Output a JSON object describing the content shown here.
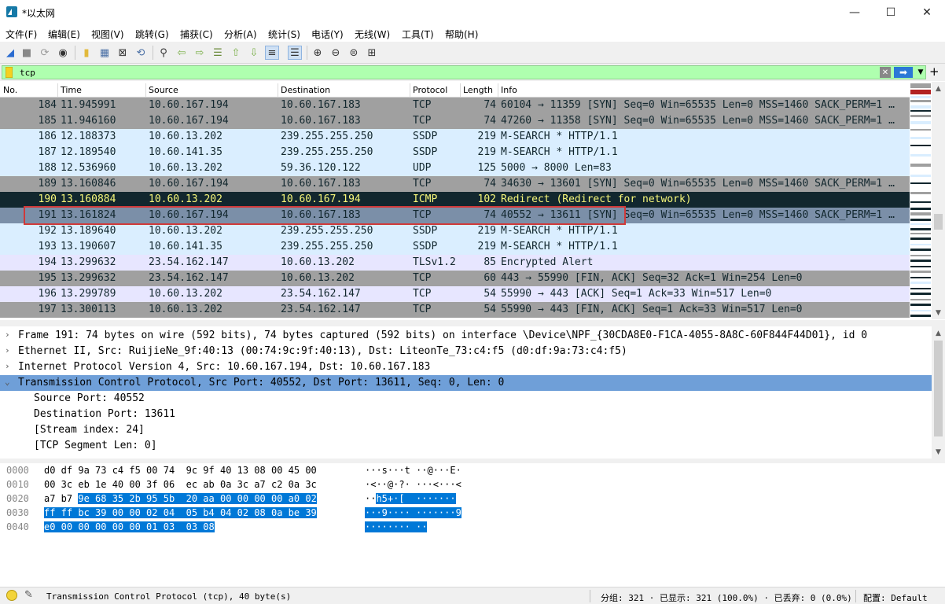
{
  "window": {
    "title": "*以太网"
  },
  "menu": [
    "文件(F)",
    "编辑(E)",
    "视图(V)",
    "跳转(G)",
    "捕获(C)",
    "分析(A)",
    "统计(S)",
    "电话(Y)",
    "无线(W)",
    "工具(T)",
    "帮助(H)"
  ],
  "filter": {
    "value": "tcp"
  },
  "columns": [
    "No.",
    "Time",
    "Source",
    "Destination",
    "Protocol",
    "Length",
    "Info"
  ],
  "packets": [
    {
      "no": "184",
      "time": "11.945991",
      "src": "10.60.167.194",
      "dst": "10.60.167.183",
      "proto": "TCP",
      "len": "74",
      "info": "60104 → 11359 [SYN] Seq=0 Win=65535 Len=0 MSS=1460 SACK_PERM=1 …",
      "bg": "#a0a0a0",
      "fg": "#12272e"
    },
    {
      "no": "185",
      "time": "11.946160",
      "src": "10.60.167.194",
      "dst": "10.60.167.183",
      "proto": "TCP",
      "len": "74",
      "info": "47260 → 11358 [SYN] Seq=0 Win=65535 Len=0 MSS=1460 SACK_PERM=1 …",
      "bg": "#a0a0a0",
      "fg": "#12272e"
    },
    {
      "no": "186",
      "time": "12.188373",
      "src": "10.60.13.202",
      "dst": "239.255.255.250",
      "proto": "SSDP",
      "len": "219",
      "info": "M-SEARCH * HTTP/1.1",
      "bg": "#daeeff",
      "fg": "#12272e"
    },
    {
      "no": "187",
      "time": "12.189540",
      "src": "10.60.141.35",
      "dst": "239.255.255.250",
      "proto": "SSDP",
      "len": "219",
      "info": "M-SEARCH * HTTP/1.1",
      "bg": "#daeeff",
      "fg": "#12272e"
    },
    {
      "no": "188",
      "time": "12.536960",
      "src": "10.60.13.202",
      "dst": "59.36.120.122",
      "proto": "UDP",
      "len": "125",
      "info": "5000 → 8000 Len=83",
      "bg": "#daeeff",
      "fg": "#12272e"
    },
    {
      "no": "189",
      "time": "13.160846",
      "src": "10.60.167.194",
      "dst": "10.60.167.183",
      "proto": "TCP",
      "len": "74",
      "info": "34630 → 13601 [SYN] Seq=0 Win=65535 Len=0 MSS=1460 SACK_PERM=1 …",
      "bg": "#a0a0a0",
      "fg": "#12272e"
    },
    {
      "no": "190",
      "time": "13.160884",
      "src": "10.60.13.202",
      "dst": "10.60.167.194",
      "proto": "ICMP",
      "len": "102",
      "info": "Redirect               (Redirect for network)",
      "bg": "#12272e",
      "fg": "#f7f77a"
    },
    {
      "no": "191",
      "time": "13.161824",
      "src": "10.60.167.194",
      "dst": "10.60.167.183",
      "proto": "TCP",
      "len": "74",
      "info": "40552 → 13611 [SYN] Seq=0 Win=65535 Len=0 MSS=1460 SACK_PERM=1 …",
      "bg": "#7b8fa8",
      "fg": "#12272e"
    },
    {
      "no": "192",
      "time": "13.189640",
      "src": "10.60.13.202",
      "dst": "239.255.255.250",
      "proto": "SSDP",
      "len": "219",
      "info": "M-SEARCH * HTTP/1.1",
      "bg": "#daeeff",
      "fg": "#12272e"
    },
    {
      "no": "193",
      "time": "13.190607",
      "src": "10.60.141.35",
      "dst": "239.255.255.250",
      "proto": "SSDP",
      "len": "219",
      "info": "M-SEARCH * HTTP/1.1",
      "bg": "#daeeff",
      "fg": "#12272e"
    },
    {
      "no": "194",
      "time": "13.299632",
      "src": "23.54.162.147",
      "dst": "10.60.13.202",
      "proto": "TLSv1.2",
      "len": "85",
      "info": "Encrypted Alert",
      "bg": "#e7e6ff",
      "fg": "#12272e"
    },
    {
      "no": "195",
      "time": "13.299632",
      "src": "23.54.162.147",
      "dst": "10.60.13.202",
      "proto": "TCP",
      "len": "60",
      "info": "443 → 55990 [FIN, ACK] Seq=32 Ack=1 Win=254 Len=0",
      "bg": "#a0a0a0",
      "fg": "#12272e"
    },
    {
      "no": "196",
      "time": "13.299789",
      "src": "10.60.13.202",
      "dst": "23.54.162.147",
      "proto": "TCP",
      "len": "54",
      "info": "55990 → 443 [ACK] Seq=1 Ack=33 Win=517 Len=0",
      "bg": "#e7e6ff",
      "fg": "#12272e"
    },
    {
      "no": "197",
      "time": "13.300113",
      "src": "10.60.13.202",
      "dst": "23.54.162.147",
      "proto": "TCP",
      "len": "54",
      "info": "55990 → 443 [FIN, ACK] Seq=1 Ack=33 Win=517 Len=0",
      "bg": "#a0a0a0",
      "fg": "#12272e"
    }
  ],
  "details": [
    {
      "expand": "›",
      "text": "Frame 191: 74 bytes on wire (592 bits), 74 bytes captured (592 bits) on interface \\Device\\NPF_{30CDA8E0-F1CA-4055-8A8C-60F844F44D01}, id 0",
      "indent": 0,
      "selected": false
    },
    {
      "expand": "›",
      "text": "Ethernet II, Src: RuijieNe_9f:40:13 (00:74:9c:9f:40:13), Dst: LiteonTe_73:c4:f5 (d0:df:9a:73:c4:f5)",
      "indent": 0,
      "selected": false
    },
    {
      "expand": "›",
      "text": "Internet Protocol Version 4, Src: 10.60.167.194, Dst: 10.60.167.183",
      "indent": 0,
      "selected": false
    },
    {
      "expand": "⌄",
      "text": "Transmission Control Protocol, Src Port: 40552, Dst Port: 13611, Seq: 0, Len: 0",
      "indent": 0,
      "selected": true
    },
    {
      "expand": "",
      "text": "Source Port: 40552",
      "indent": 1,
      "selected": false
    },
    {
      "expand": "",
      "text": "Destination Port: 13611",
      "indent": 1,
      "selected": false
    },
    {
      "expand": "",
      "text": "[Stream index: 24]",
      "indent": 1,
      "selected": false
    },
    {
      "expand": "",
      "text": "[TCP Segment Len: 0]",
      "indent": 1,
      "selected": false
    }
  ],
  "bytes": [
    {
      "offset": "0000",
      "hex_plain": "d0 df 9a 73 c4 f5 00 74  9c 9f 40 13 08 00 45 00",
      "hex_sel": "",
      "ascii_plain": "···s···t ··@···E·",
      "ascii_sel": ""
    },
    {
      "offset": "0010",
      "hex_plain": "00 3c eb 1e 40 00 3f 06  ec ab 0a 3c a7 c2 0a 3c",
      "hex_sel": "",
      "ascii_plain": "·<··@·?· ···<···<",
      "ascii_sel": ""
    },
    {
      "offset": "0020",
      "hex_plain": "a7 b7 ",
      "hex_sel": "9e 68 35 2b 95 5b  20 aa 00 00 00 00 a0 02",
      "ascii_plain": "··",
      "ascii_sel": "h5+·[  ·······"
    },
    {
      "offset": "0030",
      "hex_plain": "",
      "hex_sel": "ff ff bc 39 00 00 02 04  05 b4 04 02 08 0a be 39",
      "ascii_plain": "",
      "ascii_sel": "···9···· ·······9"
    },
    {
      "offset": "0040",
      "hex_plain": "",
      "hex_sel": "e0 00 00 00 00 00 01 03  03 08",
      "ascii_plain": "",
      "ascii_sel": "········ ··"
    }
  ],
  "status": {
    "message": "Transmission Control Protocol (tcp), 40 byte(s)",
    "packets": "分组: 321 · 已显示: 321 (100.0%) · 已丢弃: 0 (0.0%)",
    "profile": "配置: Default"
  }
}
